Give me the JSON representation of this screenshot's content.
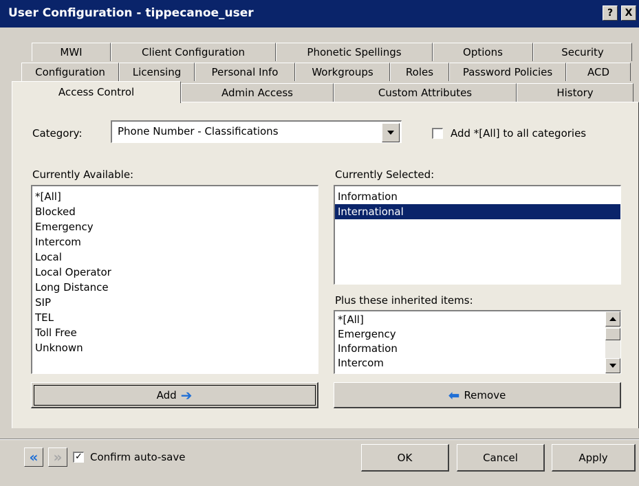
{
  "window": {
    "title": "User Configuration - tippecanoe_user",
    "help_label": "?",
    "close_label": "X"
  },
  "tabs": {
    "row1": [
      "MWI",
      "Client Configuration",
      "Phonetic Spellings",
      "Options",
      "Security"
    ],
    "row2": [
      "Configuration",
      "Licensing",
      "Personal Info",
      "Workgroups",
      "Roles",
      "Password Policies",
      "ACD"
    ],
    "row3": [
      "Access Control",
      "Admin Access",
      "Custom Attributes",
      "History"
    ],
    "active": "Access Control"
  },
  "category": {
    "label": "Category:",
    "value": "Phone Number - Classifications",
    "add_all_label": "Add *[All] to all categories",
    "add_all_checked": false
  },
  "available": {
    "label": "Currently Available:",
    "items": [
      "*[All]",
      "Blocked",
      "Emergency",
      "Intercom",
      "Local",
      "Local Operator",
      "Long Distance",
      "SIP",
      "TEL",
      "Toll Free",
      "Unknown"
    ]
  },
  "selected": {
    "label": "Currently Selected:",
    "items": [
      "Information",
      "International"
    ],
    "highlighted": "International"
  },
  "inherited": {
    "label": "Plus these inherited items:",
    "items": [
      "*[All]",
      "Emergency",
      "Information",
      "Intercom"
    ]
  },
  "buttons": {
    "add": "Add",
    "remove": "Remove",
    "ok": "OK",
    "cancel": "Cancel",
    "apply": "Apply"
  },
  "footer": {
    "confirm_label": "Confirm auto-save",
    "confirm_checked": true
  },
  "colors": {
    "titlebar": "#0a246a",
    "selection": "#0a246a",
    "arrow": "#1f6fd6"
  }
}
